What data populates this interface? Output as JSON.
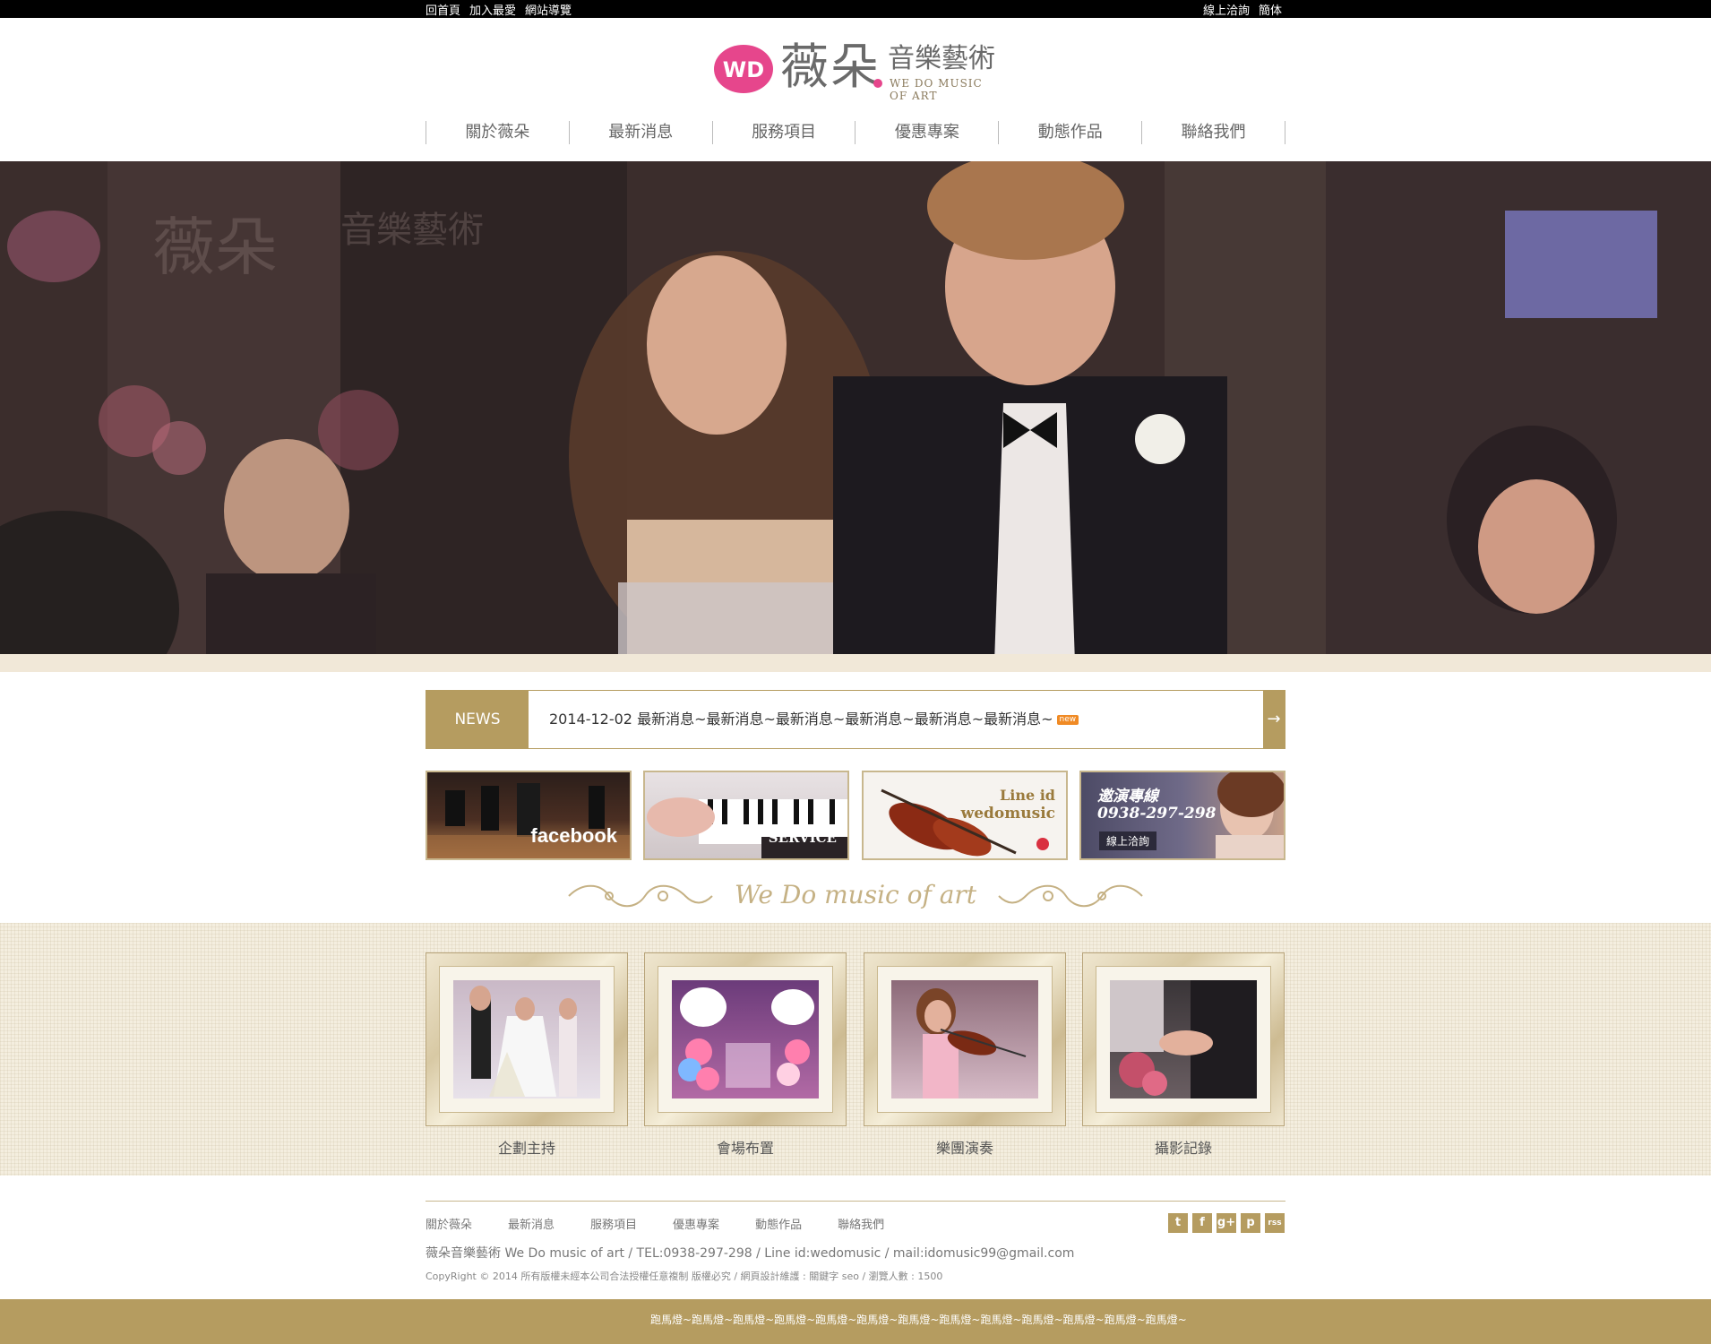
{
  "topbar": {
    "left_links": [
      "回首頁",
      "加入最愛",
      "網站導覽"
    ],
    "right_links": [
      "線上洽詢",
      "簡体"
    ]
  },
  "logo": {
    "mark_text": "WD",
    "name_cn": "薇朵",
    "name_sub": "音樂藝術",
    "name_en": "WE DO MUSIC OF ART"
  },
  "nav": {
    "items": [
      "關於薇朵",
      "最新消息",
      "服務項目",
      "優惠專案",
      "動態作品",
      "聯絡我們"
    ]
  },
  "news": {
    "tag": "NEWS",
    "text": "2014-12-02 最新消息~最新消息~最新消息~最新消息~最新消息~最新消息~",
    "badge": "new",
    "arrow": "→"
  },
  "banners": [
    {
      "label": "facebook"
    },
    {
      "label": "SERVICE"
    },
    {
      "label_line1": "Line id",
      "label_line2": "wedomusic"
    },
    {
      "label_line1": "邀演專線",
      "label_line2": "0938-297-298",
      "button": "線上洽詢"
    }
  ],
  "divider": {
    "text": "We Do music of art"
  },
  "services": [
    {
      "caption": "企劃主持"
    },
    {
      "caption": "會場布置"
    },
    {
      "caption": "樂團演奏"
    },
    {
      "caption": "攝影記錄"
    }
  ],
  "footer": {
    "nav": [
      "關於薇朵",
      "最新消息",
      "服務項目",
      "優惠專案",
      "動態作品",
      "聯絡我們"
    ],
    "info": "薇朵音樂藝術 We Do music of art / TEL:0938-297-298 / Line id:wedomusic  / mail:idomusic99@gmail.com",
    "copyright": "CopyRight © 2014 所有版權未經本公司合法授權任意複制 版權必究 / 網頁設計維護 : 關鍵字 seo / 瀏覽人數 : 1500",
    "social": [
      "t",
      "f",
      "g+",
      "p",
      "rss"
    ],
    "marquee": "跑馬燈~跑馬燈~跑馬燈~跑馬燈~跑馬燈~跑馬燈~跑馬燈~跑馬燈~跑馬燈~跑馬燈~跑馬燈~跑馬燈~跑馬燈~"
  },
  "colors": {
    "accent_gold": "#b59c60",
    "brand_pink": "#e6468c",
    "strip_cream": "#f1e8d8"
  }
}
